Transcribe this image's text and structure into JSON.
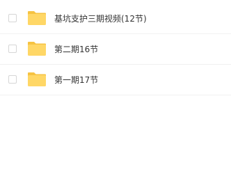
{
  "colors": {
    "folder": "#ffd766",
    "folder_tab": "#f6c342",
    "text": "#333333",
    "divider": "#f1f1f1",
    "checkbox_border": "#d6d6d6"
  },
  "file_list": {
    "items": [
      {
        "name": "基坑支护三期视频(12节)",
        "icon": "folder-icon",
        "checked": false
      },
      {
        "name": "第二期16节",
        "icon": "folder-icon",
        "checked": false
      },
      {
        "name": "第一期17节",
        "icon": "folder-icon",
        "checked": false
      }
    ]
  }
}
